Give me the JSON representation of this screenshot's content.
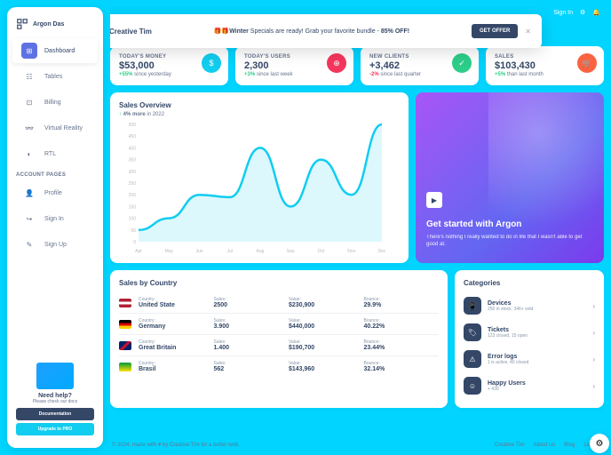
{
  "brand": "Argon Das",
  "promo": {
    "brand": "Creative Tim",
    "prefix": "🎁🎁",
    "strong": "Winter",
    "rest": " Specials are ready! Grab your favorite bundle - ",
    "discount": "85% OFF!",
    "cta": "GET OFFER"
  },
  "topbar": {
    "signin": "Sign In"
  },
  "nav": {
    "items": [
      "Dashboard",
      "Tables",
      "Billing",
      "Virtual Reality",
      "RTL"
    ],
    "section": "ACCOUNT PAGES",
    "account": [
      "Profile",
      "Sign In",
      "Sign Up"
    ]
  },
  "help": {
    "title": "Need help?",
    "sub": "Please check our docs",
    "doc": "Documentation",
    "pro": "Upgrade to PRO"
  },
  "stats": [
    {
      "label": "TODAY'S MONEY",
      "value": "$53,000",
      "delta": "+55%",
      "deltaRest": " since yesterday",
      "pos": true,
      "color": "#11cdef"
    },
    {
      "label": "TODAY'S USERS",
      "value": "2,300",
      "delta": "+3%",
      "deltaRest": " since last week",
      "pos": true,
      "color": "#f5365c"
    },
    {
      "label": "NEW CLIENTS",
      "value": "+3,462",
      "delta": "-2%",
      "deltaRest": " since last quarter",
      "pos": false,
      "color": "#2dce89"
    },
    {
      "label": "SALES",
      "value": "$103,430",
      "delta": "+5%",
      "deltaRest": " than last month",
      "pos": true,
      "color": "#fb6340"
    }
  ],
  "chart": {
    "title": "Sales Overview",
    "sub_prefix": "↑ ",
    "sub_bold": "4% more",
    "sub_rest": " in 2022"
  },
  "chart_data": {
    "type": "line",
    "title": "Sales Overview",
    "xlabel": "",
    "ylabel": "",
    "categories": [
      "Apr",
      "May",
      "Jun",
      "Jul",
      "Aug",
      "Sep",
      "Oct",
      "Nov",
      "Dec"
    ],
    "values": [
      50,
      100,
      200,
      190,
      400,
      150,
      350,
      200,
      500
    ],
    "ylim": [
      0,
      500
    ],
    "yticks": [
      0,
      50,
      100,
      150,
      200,
      250,
      300,
      350,
      400,
      450,
      500
    ]
  },
  "promo_card": {
    "title": "Get started with Argon",
    "text": "There's nothing I really wanted to do in life that I wasn't able to get good at."
  },
  "countries": {
    "title": "Sales by Country",
    "headers": {
      "country": "Country:",
      "sales": "Sales:",
      "value": "Value:",
      "bounce": "Bounce:"
    },
    "rows": [
      {
        "name": "United State",
        "sales": "2500",
        "value": "$230,900",
        "bounce": "29.9%",
        "flag": "us"
      },
      {
        "name": "Germany",
        "sales": "3.900",
        "value": "$440,000",
        "bounce": "40.22%",
        "flag": "de"
      },
      {
        "name": "Great Britain",
        "sales": "1.400",
        "value": "$190,700",
        "bounce": "23.44%",
        "flag": "gb"
      },
      {
        "name": "Brasil",
        "sales": "562",
        "value": "$143,960",
        "bounce": "32.14%",
        "flag": "br"
      }
    ]
  },
  "categories": {
    "title": "Categories",
    "rows": [
      {
        "name": "Devices",
        "sub": "250 in stock, 346+ sold"
      },
      {
        "name": "Tickets",
        "sub": "123 closed, 15 open"
      },
      {
        "name": "Error logs",
        "sub": "1 is active, 40 closed"
      },
      {
        "name": "Happy Users",
        "sub": "+ 430"
      }
    ]
  },
  "footer": {
    "copyright": "© 2024, made with ♥ by Creative Tim for a better web.",
    "links": [
      "Creative Tim",
      "About Us",
      "Blog",
      "License"
    ]
  }
}
